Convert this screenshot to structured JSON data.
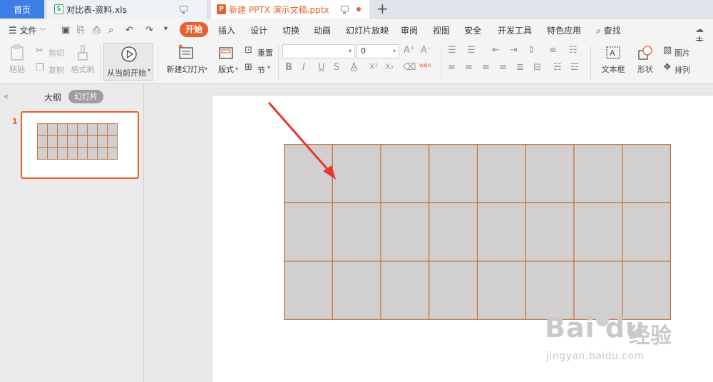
{
  "tabs": {
    "home": "首页",
    "xls": "对比表-资料.xls",
    "xls_icon": "S",
    "ppt": "新建 PPTX 演示文稿.pptx",
    "ppt_icon": "P",
    "new_tab": "+"
  },
  "menu": {
    "file": "文件",
    "start": "开始",
    "items": [
      "插入",
      "设计",
      "切换",
      "动画",
      "幻灯片放映",
      "审阅",
      "视图",
      "安全",
      "开发工具",
      "特色应用"
    ],
    "search": "查找",
    "cloud_label": "未"
  },
  "ribbon": {
    "paste": "粘贴",
    "cut": "剪切",
    "copy": "复制",
    "format_painter": "格式刷",
    "play_from_current": "从当前开始",
    "new_slide": "新建幻灯片",
    "layout": "版式",
    "reset": "重置",
    "section": "节",
    "font_size_value": "0",
    "text_box": "文本框",
    "shape": "形状",
    "picture": "图片",
    "arrange": "排列",
    "phonetic": "wén"
  },
  "left_pane": {
    "collapse": "«",
    "outline_tab": "大纲",
    "slides_tab": "幻灯片",
    "slide_number": "1"
  },
  "slide_table": {
    "rows": 3,
    "cols": 8,
    "fill_color": "#d1cfd0",
    "border_color": "#c7733e"
  },
  "annotation": {
    "arrow_color": "#e8382b"
  },
  "watermark": {
    "brand": "Bai du",
    "brand_cn": "经验",
    "url": "jingyan.baidu.com"
  },
  "colors": {
    "accent": "#e8602c",
    "home_tab": "#3d7ee6"
  }
}
